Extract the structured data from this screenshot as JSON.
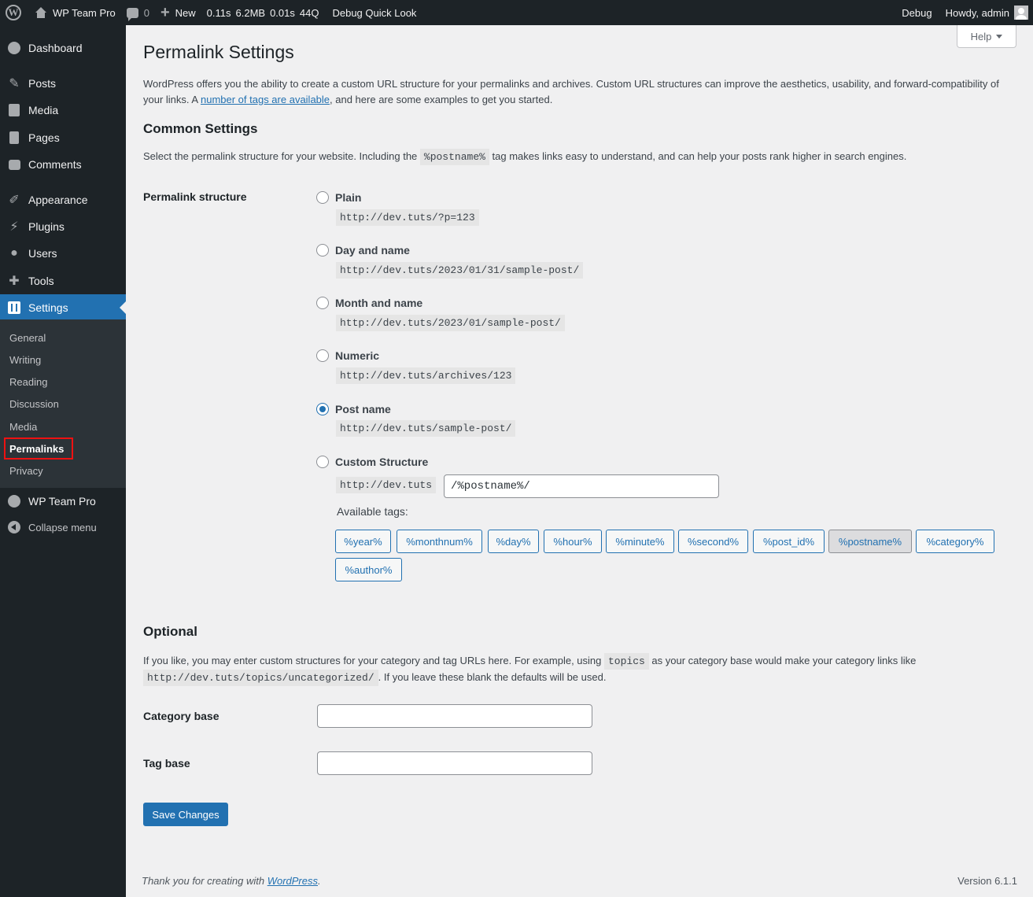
{
  "adminbar": {
    "site_name": "WP Team Pro",
    "comments_count": "0",
    "new_label": "New",
    "stats": [
      "0.11s",
      "6.2MB",
      "0.01s",
      "44Q"
    ],
    "debug_quick_look": "Debug Quick Look",
    "debug_label": "Debug",
    "howdy": "Howdy, admin"
  },
  "sidebar": {
    "items": [
      {
        "label": "Dashboard",
        "icon": "dashboard-icon"
      },
      {
        "label": "Posts",
        "icon": "pin-icon"
      },
      {
        "label": "Media",
        "icon": "media-icon"
      },
      {
        "label": "Pages",
        "icon": "page-icon"
      },
      {
        "label": "Comments",
        "icon": "comment-icon"
      },
      {
        "label": "Appearance",
        "icon": "brush-icon"
      },
      {
        "label": "Plugins",
        "icon": "plugin-icon"
      },
      {
        "label": "Users",
        "icon": "user-icon"
      },
      {
        "label": "Tools",
        "icon": "wrench-icon"
      },
      {
        "label": "Settings",
        "icon": "settings-icon"
      }
    ],
    "submenu": [
      "General",
      "Writing",
      "Reading",
      "Discussion",
      "Media",
      "Permalinks",
      "Privacy"
    ],
    "team_pro": "WP Team Pro",
    "collapse": "Collapse menu"
  },
  "help_label": "Help",
  "page": {
    "title": "Permalink Settings",
    "intro_before": "WordPress offers you the ability to create a custom URL structure for your permalinks and archives. Custom URL structures can improve the aesthetics, usability, and forward-compatibility of your links. A ",
    "intro_link": "number of tags are available",
    "intro_after": ", and here are some examples to get you started."
  },
  "common": {
    "heading": "Common Settings",
    "desc_before": "Select the permalink structure for your website. Including the ",
    "desc_code": "%postname%",
    "desc_after": " tag makes links easy to understand, and can help your posts rank higher in search engines.",
    "structure_label": "Permalink structure",
    "options": [
      {
        "label": "Plain",
        "example": "http://dev.tuts/?p=123",
        "checked": false
      },
      {
        "label": "Day and name",
        "example": "http://dev.tuts/2023/01/31/sample-post/",
        "checked": false
      },
      {
        "label": "Month and name",
        "example": "http://dev.tuts/2023/01/sample-post/",
        "checked": false
      },
      {
        "label": "Numeric",
        "example": "http://dev.tuts/archives/123",
        "checked": false
      },
      {
        "label": "Post name",
        "example": "http://dev.tuts/sample-post/",
        "checked": true
      },
      {
        "label": "Custom Structure",
        "example": "http://dev.tuts",
        "checked": false
      }
    ],
    "custom_value": "/%postname%/",
    "available_tags_label": "Available tags:",
    "tags": [
      "%year%",
      "%monthnum%",
      "%day%",
      "%hour%",
      "%minute%",
      "%second%",
      "%post_id%",
      "%postname%",
      "%category%",
      "%author%"
    ],
    "active_tag": "%postname%"
  },
  "optional": {
    "heading": "Optional",
    "desc1_before": "If you like, you may enter custom structures for your category and tag URLs here. For example, using ",
    "desc1_code": "topics",
    "desc1_after": " as your category base would make your category links like",
    "desc2_code": "http://dev.tuts/topics/uncategorized/",
    "desc2_after": ". If you leave these blank the defaults will be used.",
    "category_base_label": "Category base",
    "category_base_value": "",
    "tag_base_label": "Tag base",
    "tag_base_value": ""
  },
  "save_label": "Save Changes",
  "footer": {
    "thanks_before": "Thank you for creating with ",
    "thanks_link": "WordPress",
    "thanks_after": ".",
    "version": "Version 6.1.1"
  }
}
